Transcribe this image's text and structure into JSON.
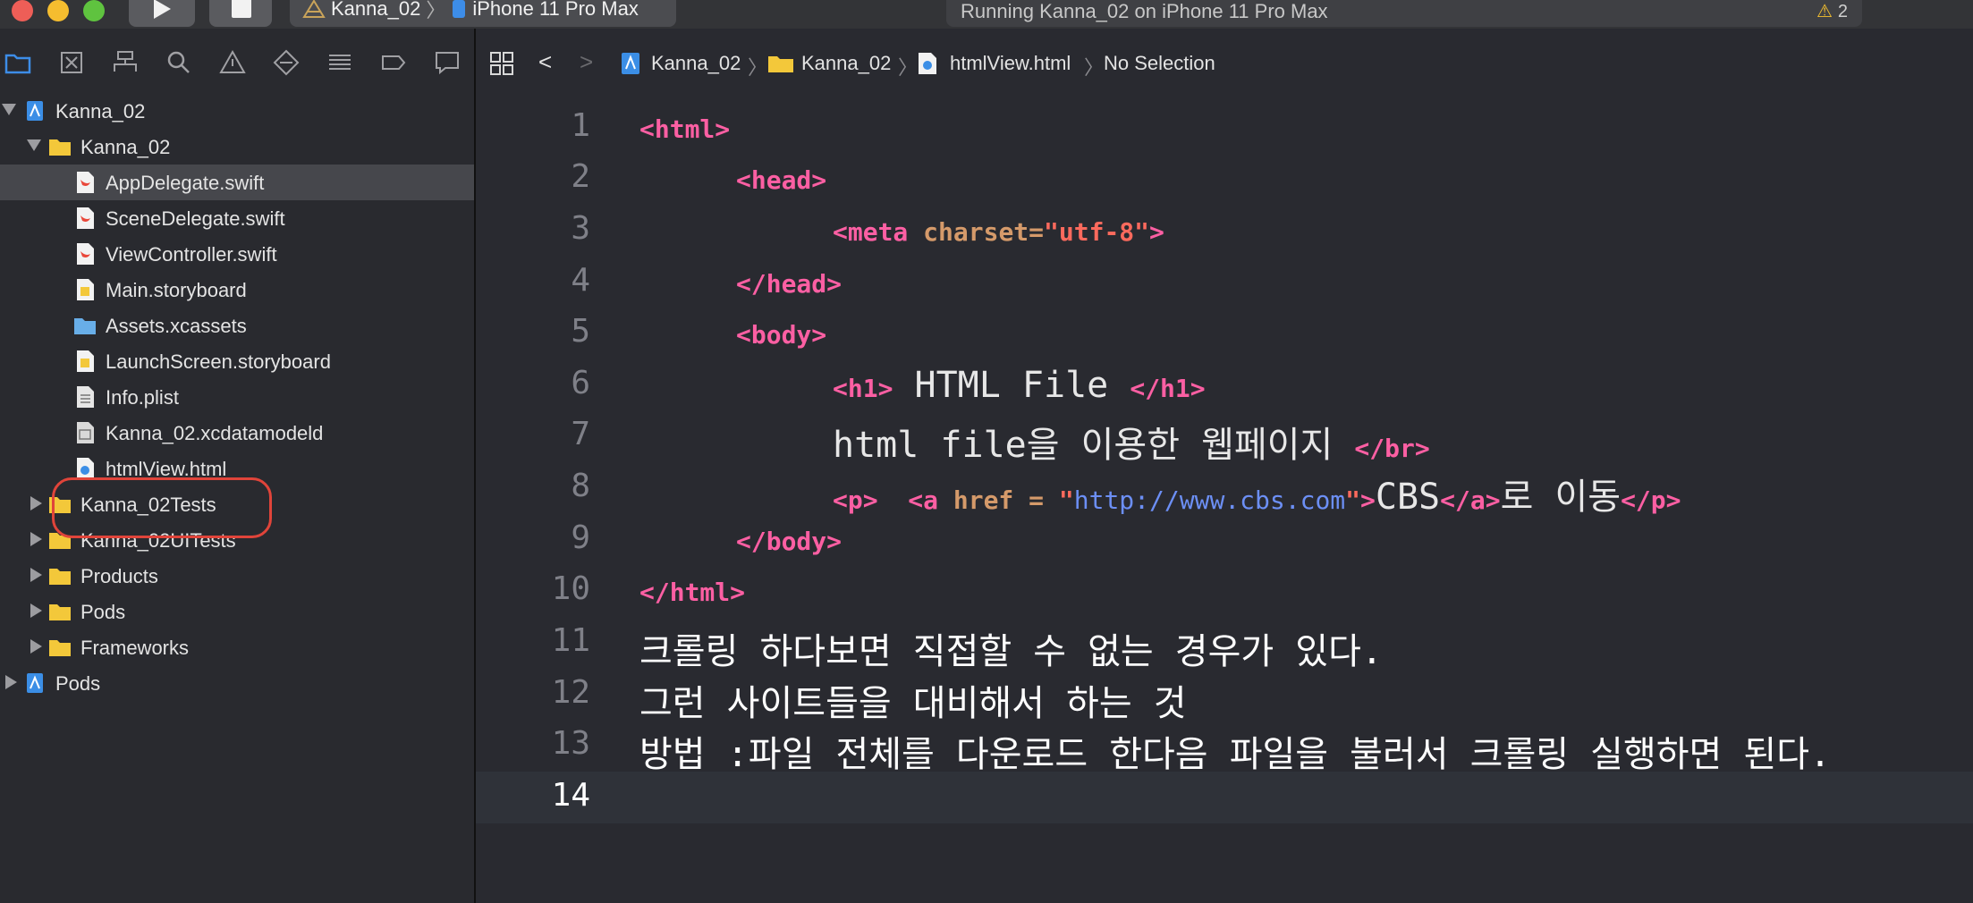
{
  "toolbar": {
    "scheme_target": "Kanna_02",
    "scheme_device": "iPhone 11 Pro Max",
    "activity": "Running Kanna_02 on iPhone 11 Pro Max",
    "warning_count": "2"
  },
  "navigator": {
    "toolbar_icons": [
      "folder-icon",
      "source-control-icon",
      "hierarchy-icon",
      "search-icon",
      "warning-icon",
      "test-icon",
      "debug-icon",
      "breakpoint-icon",
      "report-icon"
    ],
    "items": [
      {
        "label": "Kanna_02",
        "icon": "project-icon",
        "depth": 0,
        "disclosure": "open"
      },
      {
        "label": "Kanna_02",
        "icon": "folder-icon",
        "depth": 1,
        "disclosure": "open"
      },
      {
        "label": "AppDelegate.swift",
        "icon": "swift-file-icon",
        "depth": 2,
        "selected": true
      },
      {
        "label": "SceneDelegate.swift",
        "icon": "swift-file-icon",
        "depth": 2
      },
      {
        "label": "ViewController.swift",
        "icon": "swift-file-icon",
        "depth": 2
      },
      {
        "label": "Main.storyboard",
        "icon": "storyboard-icon",
        "depth": 2
      },
      {
        "label": "Assets.xcassets",
        "icon": "assets-folder-icon",
        "depth": 2
      },
      {
        "label": "LaunchScreen.storyboard",
        "icon": "storyboard-icon",
        "depth": 2
      },
      {
        "label": "Info.plist",
        "icon": "plist-icon",
        "depth": 2
      },
      {
        "label": "Kanna_02.xcdatamodeld",
        "icon": "datamodel-icon",
        "depth": 2
      },
      {
        "label": "htmlView.html",
        "icon": "html-file-icon",
        "depth": 2
      },
      {
        "label": "Kanna_02Tests",
        "icon": "folder-icon",
        "depth": 1,
        "disclosure": "closed"
      },
      {
        "label": "Kanna_02UITests",
        "icon": "folder-icon",
        "depth": 1,
        "disclosure": "closed"
      },
      {
        "label": "Products",
        "icon": "folder-icon",
        "depth": 1,
        "disclosure": "closed"
      },
      {
        "label": "Pods",
        "icon": "folder-icon",
        "depth": 1,
        "disclosure": "closed"
      },
      {
        "label": "Frameworks",
        "icon": "folder-icon",
        "depth": 1,
        "disclosure": "closed"
      },
      {
        "label": "Pods",
        "icon": "project-icon",
        "depth": 0,
        "disclosure": "closed"
      }
    ]
  },
  "jumpbar": {
    "project": "Kanna_02",
    "group": "Kanna_02",
    "file": "htmlView.html",
    "selection": "No Selection"
  },
  "editor": {
    "current_line": "14",
    "lines": [
      {
        "n": "1",
        "indent": 0,
        "parts": [
          {
            "t": "<html>",
            "c": "tag"
          }
        ]
      },
      {
        "n": "2",
        "indent": 1,
        "parts": [
          {
            "t": "<head>",
            "c": "tag"
          }
        ]
      },
      {
        "n": "3",
        "indent": 2,
        "parts": [
          {
            "t": "<meta ",
            "c": "tag"
          },
          {
            "t": "charset=",
            "c": "attr"
          },
          {
            "t": "\"utf-8\"",
            "c": "str"
          },
          {
            "t": ">",
            "c": "tag"
          }
        ]
      },
      {
        "n": "4",
        "indent": 1,
        "parts": [
          {
            "t": "</head>",
            "c": "tag"
          }
        ]
      },
      {
        "n": "5",
        "indent": 1,
        "parts": [
          {
            "t": "<body>",
            "c": "tag"
          }
        ]
      },
      {
        "n": "6",
        "indent": 2,
        "parts": [
          {
            "t": "<h1>",
            "c": "tag"
          },
          {
            "t": " HTML File ",
            "c": "big"
          },
          {
            "t": "</h1>",
            "c": "tag"
          }
        ]
      },
      {
        "n": "7",
        "indent": 2,
        "parts": [
          {
            "t": "html file을 이용한 웹페이지 ",
            "c": "big"
          },
          {
            "t": "</br>",
            "c": "tag"
          }
        ]
      },
      {
        "n": "8",
        "indent": 2,
        "parts": [
          {
            "t": "<p>  <a ",
            "c": "tag"
          },
          {
            "t": "href = ",
            "c": "attr"
          },
          {
            "t": "\"",
            "c": "str"
          },
          {
            "t": "http://www.cbs.com",
            "c": "url"
          },
          {
            "t": "\"",
            "c": "str"
          },
          {
            "t": ">",
            "c": "tag"
          },
          {
            "t": "CBS",
            "c": "big"
          },
          {
            "t": "</a>",
            "c": "tag"
          },
          {
            "t": "로 이동",
            "c": "big"
          },
          {
            "t": "</p>",
            "c": "tag"
          }
        ]
      },
      {
        "n": "9",
        "indent": 1,
        "parts": [
          {
            "t": "</body>",
            "c": "tag"
          }
        ]
      },
      {
        "n": "10",
        "indent": 0,
        "parts": [
          {
            "t": "</html>",
            "c": "tag"
          }
        ]
      },
      {
        "n": "11",
        "indent": 0,
        "parts": [
          {
            "t": "크롤링 하다보면 직접할 수 없는 경우가 있다.",
            "c": "plain"
          }
        ]
      },
      {
        "n": "12",
        "indent": 0,
        "parts": [
          {
            "t": "그런 사이트들을 대비해서 하는 것",
            "c": "plain"
          }
        ]
      },
      {
        "n": "13",
        "indent": 0,
        "parts": [
          {
            "t": "방법 :파일 전체를 다운로드 한다음 파일을 불러서 크롤링 실행하면 된다.",
            "c": "plain"
          }
        ]
      },
      {
        "n": "14",
        "indent": 0,
        "parts": []
      }
    ]
  }
}
